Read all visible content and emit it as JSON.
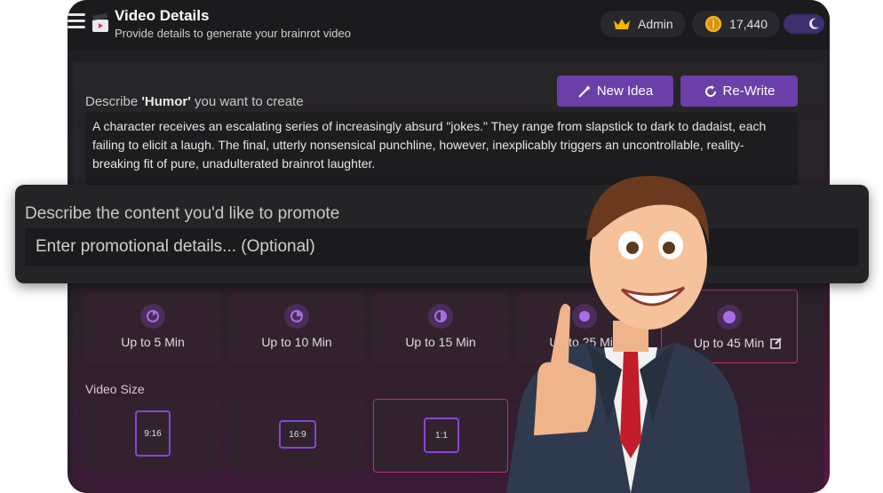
{
  "header": {
    "title": "Video Details",
    "subtitle": "Provide details to generate your brainrot video",
    "admin_label": "Admin",
    "credits": "17,440"
  },
  "describe": {
    "label_prefix": "Describe ",
    "label_topic": "'Humor'",
    "label_suffix": " you want to create",
    "new_idea": "New Idea",
    "rewrite": "Re-Write",
    "text": "A character receives an escalating series of increasingly absurd \"jokes.\" They range from slapstick to dark to dadaist, each failing to elicit a laugh. The final, utterly nonsensical punchline, however, inexplicably triggers an uncontrollable, reality-breaking fit of pure, unadulterated brainrot laughter."
  },
  "promote": {
    "label": "Describe the content you'd like to promote",
    "placeholder": "Enter promotional details... (Optional)"
  },
  "durations": [
    "Up to 5 Min",
    "Up to 10 Min",
    "Up to 15 Min",
    "Up to 25 Min",
    "Up to 45 Min"
  ],
  "duration_selected": "Up to 45 Min",
  "video_size": {
    "label": "Video Size",
    "options": [
      "9:16",
      "16:9",
      "1:1"
    ],
    "selected": "1:1"
  },
  "colors": {
    "accent": "#6a3fa8",
    "selected_border": "#c0307a",
    "background": "#1f1f22"
  }
}
